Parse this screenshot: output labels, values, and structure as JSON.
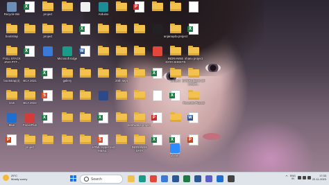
{
  "desktop": {
    "icons": [
      {
        "label": "Recycle Bin",
        "kind": "app",
        "color": "#6d8fb5"
      },
      {
        "label": "bootstrap",
        "kind": "folder"
      },
      {
        "label": "FULL STACK JAVA PYT...",
        "kind": "folder"
      },
      {
        "label": "bootstrap(4)",
        "kind": "folder"
      },
      {
        "label": "new",
        "kind": "folder"
      },
      {
        "label": "Blue",
        "kind": "app",
        "color": "#1f6fd1"
      },
      {
        "label": "",
        "kind": "pp",
        "tag": "P"
      },
      {
        "label": "",
        "kind": "xl",
        "tag": "X"
      },
      {
        "label": "",
        "kind": "folder"
      },
      {
        "label": "",
        "kind": "xl",
        "tag": "X"
      },
      {
        "label": "BCA 2021",
        "kind": "folder"
      },
      {
        "label": "BCA 2022",
        "kind": "folder"
      },
      {
        "label": "FocusPlus",
        "kind": "app",
        "color": "#d43b3b"
      },
      {
        "label": "project",
        "kind": "folder"
      },
      {
        "label": "project",
        "kind": "folder"
      },
      {
        "label": "project",
        "kind": "folder"
      },
      {
        "label": "",
        "kind": "app",
        "color": "#3a7ad9"
      },
      {
        "label": "",
        "kind": "xl",
        "tag": "X"
      },
      {
        "label": "",
        "kind": "ht",
        "tag": "5"
      },
      {
        "label": "",
        "kind": "xl",
        "tag": "X"
      },
      {
        "label": "",
        "kind": "folder"
      },
      {
        "label": "",
        "kind": "folder"
      },
      {
        "label": "",
        "kind": "folder"
      },
      {
        "label": "Microsoft Edge",
        "kind": "app",
        "color": "#1b9a87"
      },
      {
        "label": "gallery",
        "kind": "folder"
      },
      {
        "label": "",
        "kind": "folder"
      },
      {
        "label": "",
        "kind": "folder"
      },
      {
        "label": "",
        "kind": "folder"
      },
      {
        "label": "",
        "kind": "app",
        "color": "#f0f0f0"
      },
      {
        "label": "",
        "kind": "xl",
        "tag": "X"
      },
      {
        "label": "",
        "kind": "wd",
        "tag": "W"
      },
      {
        "label": "",
        "kind": "folder"
      },
      {
        "label": "",
        "kind": "folder"
      },
      {
        "label": "",
        "kind": "folder"
      },
      {
        "label": "",
        "kind": "folder"
      },
      {
        "label": "Arduino",
        "kind": "app",
        "color": "#1c8c96"
      },
      {
        "label": "",
        "kind": "folder"
      },
      {
        "label": "",
        "kind": "folder"
      },
      {
        "label": "",
        "kind": "folder"
      },
      {
        "label": "",
        "kind": "app",
        "color": "#2c4a8a"
      },
      {
        "label": "",
        "kind": "xl",
        "tag": "X"
      },
      {
        "label": "HTML Hyper text Marku...",
        "kind": "ht",
        "tag": "5"
      },
      {
        "label": "",
        "kind": "folder"
      },
      {
        "label": "",
        "kind": "folder"
      },
      {
        "label": "",
        "kind": "folder"
      },
      {
        "label": "20th sept",
        "kind": "folder"
      },
      {
        "label": "",
        "kind": "folder"
      },
      {
        "label": "",
        "kind": "folder"
      },
      {
        "label": "",
        "kind": "folder"
      },
      {
        "label": "",
        "kind": "pdf",
        "tag": "P"
      },
      {
        "label": "",
        "kind": "folder"
      },
      {
        "label": "",
        "kind": "folder"
      },
      {
        "label": "",
        "kind": "folder"
      },
      {
        "label": "",
        "kind": "folder"
      },
      {
        "label": "anshwaria project",
        "kind": "folder"
      },
      {
        "label": "INDRANNE DATA",
        "kind": "folder"
      },
      {
        "label": "",
        "kind": "folder"
      },
      {
        "label": "",
        "kind": "app",
        "color": "#222222"
      },
      {
        "label": "",
        "kind": "app",
        "color": "#e2473a"
      },
      {
        "label": "",
        "kind": "xl",
        "tag": "X"
      },
      {
        "label": "",
        "kind": "doc"
      },
      {
        "label": "",
        "kind": "pdf",
        "tag": "P"
      },
      {
        "label": "",
        "kind": "xl",
        "tag": "X"
      },
      {
        "label": "",
        "kind": "folder"
      },
      {
        "label": "anjanaydu project",
        "kind": "folder"
      },
      {
        "label": "INDRANNE DATA SHEETS",
        "kind": "folder"
      },
      {
        "label": "project",
        "kind": "folder"
      },
      {
        "label": "",
        "kind": "xl",
        "tag": "X"
      },
      {
        "label": "",
        "kind": "folder"
      },
      {
        "label": "",
        "kind": "xl",
        "tag": "X"
      },
      {
        "label": "",
        "kind": "doc"
      },
      {
        "label": "",
        "kind": "xl",
        "tag": "X"
      },
      {
        "label": "shanu project",
        "kind": "folder"
      },
      {
        "label": "INTERVIEWS OF COMP...",
        "kind": "folder"
      },
      {
        "label": "Recently Placed",
        "kind": "folder"
      },
      {
        "label": "",
        "kind": "wd",
        "tag": "W"
      },
      {
        "label": "",
        "kind": "pp",
        "tag": "P"
      },
      {
        "label": "",
        "kind": "doc"
      },
      {
        "label": "",
        "kind": "app",
        "color": "#888888"
      },
      {
        "label": "",
        "kind": "doc"
      },
      {
        "label": "",
        "kind": "wd",
        "tag": "W"
      },
      {
        "label": "Zoom",
        "kind": "app",
        "color": "#2d8cff"
      }
    ]
  },
  "taskbar": {
    "weather_temp": "29°C",
    "weather_desc": "Mostly sunny",
    "search_placeholder": "Search",
    "apps": [
      {
        "name": "file-explorer",
        "color": "#f2c14e"
      },
      {
        "name": "edge",
        "color": "#1b9a87"
      },
      {
        "name": "chrome",
        "color": "#e2473a"
      },
      {
        "name": "store",
        "color": "#3a7ad9"
      },
      {
        "name": "mail",
        "color": "#2b5797"
      },
      {
        "name": "excel",
        "color": "#1d7a45"
      },
      {
        "name": "word",
        "color": "#2b5797"
      },
      {
        "name": "teams",
        "color": "#5b5fc7"
      },
      {
        "name": "vscode",
        "color": "#1f6fd1"
      },
      {
        "name": "other",
        "color": "#444444"
      }
    ],
    "lang_top": "ENG",
    "lang_bottom": "IN",
    "time": "17:33",
    "date": "22-11-2023"
  }
}
